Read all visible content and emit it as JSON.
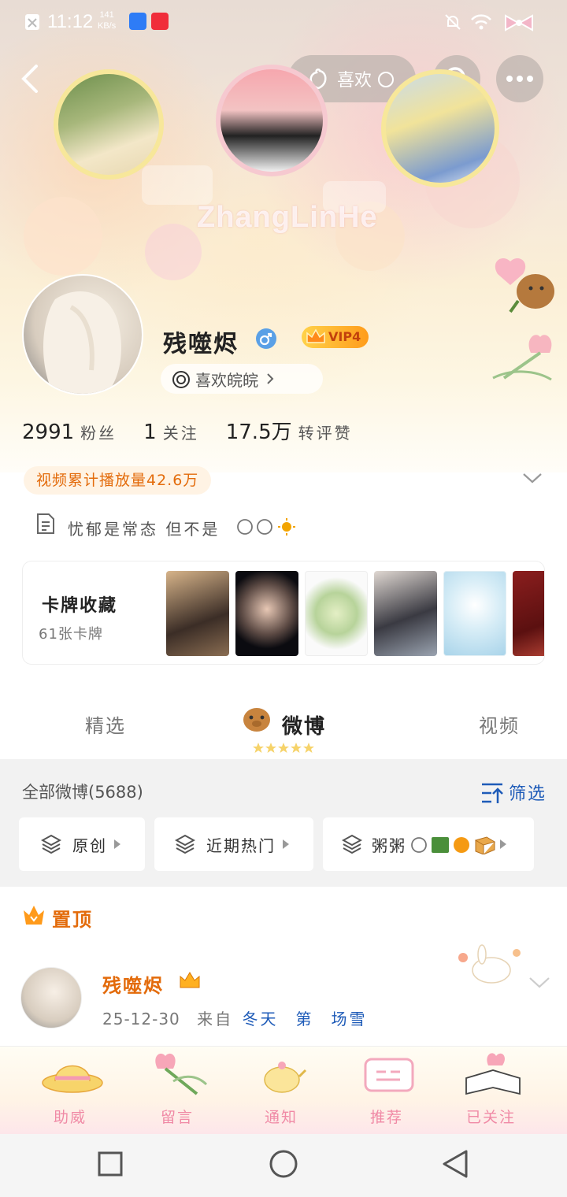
{
  "status_bar": {
    "time": "11:12",
    "speed_value": "141",
    "speed_unit": "KB/s"
  },
  "header": {
    "like_label": "喜欢",
    "watermark": "ZhangLinHe"
  },
  "profile": {
    "name": "残噬烬",
    "vip_label": "VIP4",
    "like_tag": "喜欢皖皖",
    "stats": [
      {
        "value": "2991",
        "label": "粉丝"
      },
      {
        "value": "1",
        "label": "关注"
      },
      {
        "value": "17.5万",
        "label": "转评赞"
      }
    ],
    "views": "视频累计播放量42.6万",
    "bio": "忧郁是常态 但不是"
  },
  "cards": {
    "title": "卡牌收藏",
    "count": "61张卡牌"
  },
  "tabs": {
    "featured": "精选",
    "weibo": "微博",
    "video": "视频"
  },
  "feed": {
    "all_label": "全部微博(5688)",
    "filter_label": "筛选",
    "chips": [
      "原创",
      "近期热门",
      "粥粥"
    ]
  },
  "pinned": {
    "label": "置顶",
    "name": "残噬烬",
    "date": "25-12-30",
    "source_prefix": "来自",
    "source": "冬天",
    "source_mid": "第",
    "source_end": "场雪"
  },
  "bottom_deco": [
    "助威",
    "留言",
    "通知",
    "推荐",
    "已关注"
  ],
  "colors": {
    "accent_orange": "#e36b0b",
    "vip_gold": "#ffb020",
    "blue_filter": "#1e5bb8",
    "deco_pink": "#f08aa6"
  }
}
